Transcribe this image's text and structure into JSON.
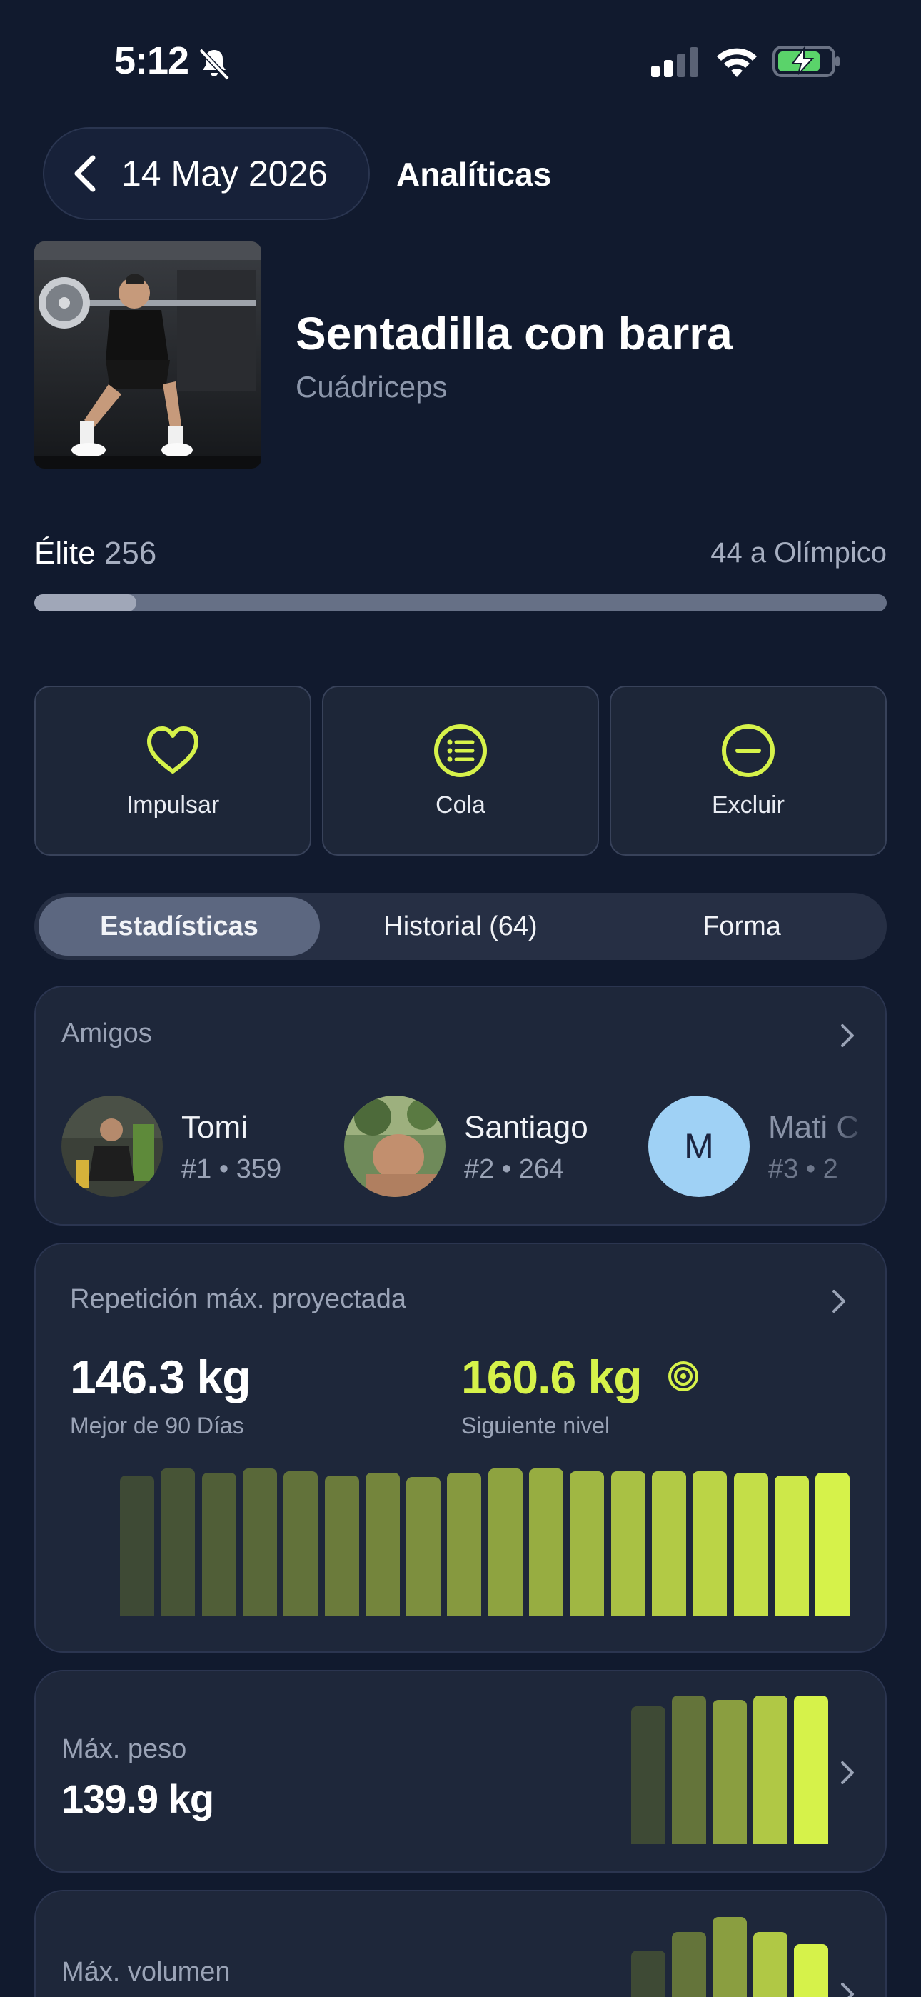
{
  "status_bar": {
    "time": "5:12"
  },
  "header": {
    "date": "14 May 2026",
    "title": "Analíticas"
  },
  "exercise": {
    "name": "Sentadilla con barra",
    "muscle": "Cuádriceps"
  },
  "rank": {
    "label": "Élite",
    "value": "256",
    "next": "44 a Olímpico",
    "progress_fraction": 0.12
  },
  "actions": [
    {
      "label": "Impulsar",
      "icon": "heart-icon"
    },
    {
      "label": "Cola",
      "icon": "list-icon"
    },
    {
      "label": "Excluir",
      "icon": "minus-circle-icon"
    }
  ],
  "tabs": [
    {
      "label": "Estadísticas",
      "active": true
    },
    {
      "label": "Historial (64)",
      "active": false
    },
    {
      "label": "Forma",
      "active": false
    }
  ],
  "friends": {
    "title": "Amigos",
    "items": [
      {
        "name": "Tomi",
        "rank": "#1",
        "score": "359",
        "sub": "#1 • 359"
      },
      {
        "name": "Santiago",
        "rank": "#2",
        "score": "264",
        "sub": "#2 • 264"
      },
      {
        "name": "Mati C",
        "initial": "M",
        "rank": "#3",
        "score": "2",
        "sub": "#3 • 2"
      }
    ]
  },
  "one_rep_max": {
    "title": "Repetición máx. proyectada",
    "best_value": "146.3 kg",
    "best_label": "Mejor de 90 Días",
    "next_value": "160.6 kg",
    "next_label": "Siguiente nivel",
    "bars": [
      0.95,
      1.0,
      0.97,
      1.0,
      0.98,
      0.95,
      0.97,
      0.94,
      0.97,
      1.0,
      1.0,
      0.98,
      0.98,
      0.98,
      0.98,
      0.97,
      0.95,
      0.97
    ]
  },
  "max_weight": {
    "title": "Máx. peso",
    "value": "139.9 kg",
    "bars": [
      0.93,
      1.0,
      0.97,
      1.0,
      1.0
    ]
  },
  "max_volume": {
    "title": "Máx. volumen",
    "bars": [
      0.78,
      0.9,
      1.0,
      0.9,
      0.82
    ]
  },
  "colors": {
    "background": "#111a2e",
    "accent": "#d6f24a",
    "bar_dark": "#3e4a35",
    "bar_light": "#d6f24a"
  }
}
